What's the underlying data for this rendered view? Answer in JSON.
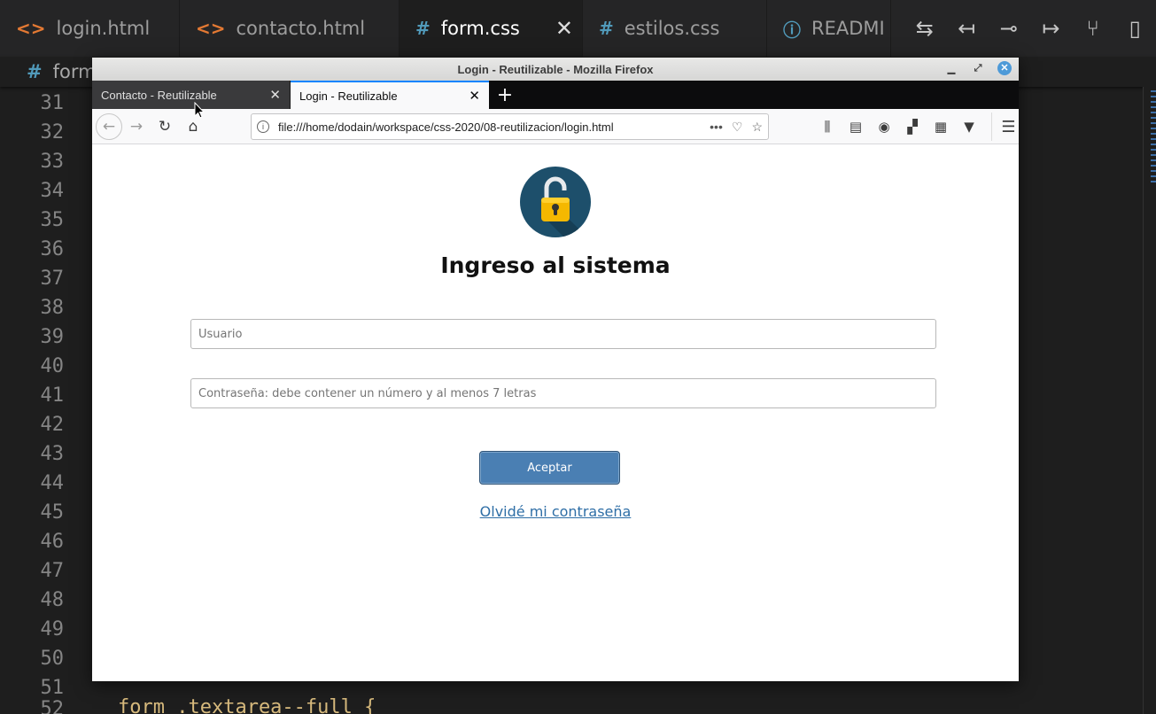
{
  "editor": {
    "tabs": [
      {
        "icon": "<>",
        "label": "login.html"
      },
      {
        "icon": "<>",
        "label": "contacto.html"
      },
      {
        "icon": "#",
        "label": "form.css",
        "close": "✕"
      },
      {
        "icon": "#",
        "label": "estilos.css"
      },
      {
        "icon": "ⓘ",
        "label": "READMI"
      }
    ],
    "breadcrumb": {
      "icon": "#",
      "label": "form"
    },
    "line_numbers": [
      "31",
      "32",
      "33",
      "34",
      "35",
      "36",
      "37",
      "38",
      "39",
      "40",
      "41",
      "42",
      "43",
      "44",
      "45",
      "46",
      "47",
      "48",
      "49",
      "50",
      "51",
      "52"
    ],
    "code_line": "form .textarea--full {"
  },
  "browser": {
    "window_title": "Login - Reutilizable - Mozilla Firefox",
    "tabs": [
      {
        "label": "Contacto - Reutilizable",
        "close": "✕"
      },
      {
        "label": "Login - Reutilizable",
        "close": "✕"
      }
    ],
    "new_tab": "+",
    "url": "file:///home/dodain/workspace/css-2020/08-reutilizacion/login.html",
    "url_more": "•••"
  },
  "page": {
    "title": "Ingreso al sistema",
    "user_placeholder": "Usuario",
    "password_placeholder": "Contraseña: debe contener un número y al menos 7 letras",
    "submit_label": "Aceptar",
    "forgot_label": "Olvidé mi contraseña"
  }
}
